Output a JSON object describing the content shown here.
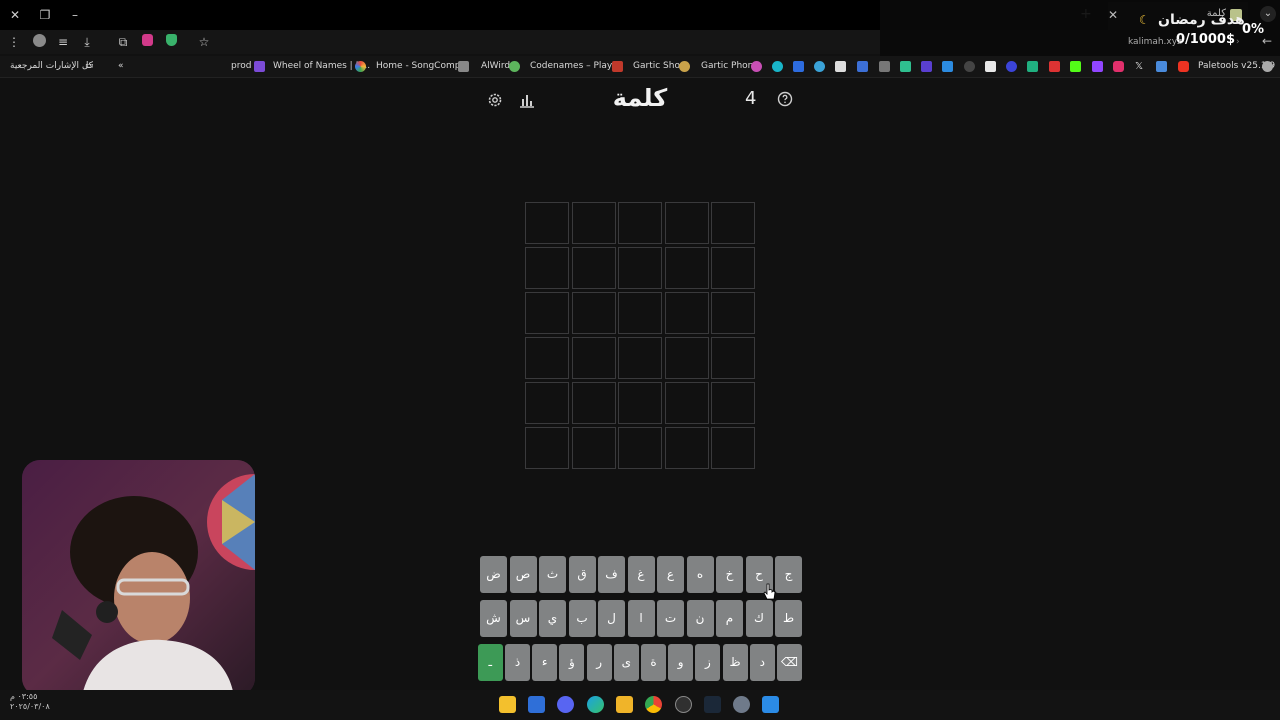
{
  "browser": {
    "tab_title": "كلمة",
    "url_domain": "kalimah.xyz",
    "all_bookmarks_label": "كل الإشارات المرجعية",
    "bookmarks": [
      "prod",
      "Wheel of Names | R...",
      "Home - SongComp...",
      "AlWird",
      "Codenames – Play...",
      "Gartic Show",
      "Gartic Phone",
      "Paletools v25.1.9"
    ]
  },
  "overlay": {
    "goal_label": "هدف رمضان",
    "goal_percent": "0%",
    "goal_amount": "0/1000$"
  },
  "game": {
    "title": "كلمة",
    "attempts": "4",
    "rows": 6,
    "cols": 5
  },
  "keyboard": {
    "row1": [
      "ج",
      "ح",
      "خ",
      "ه",
      "ع",
      "غ",
      "ف",
      "ق",
      "ث",
      "ص",
      "ض"
    ],
    "row2": [
      "ط",
      "ك",
      "م",
      "ن",
      "ت",
      "ا",
      "ل",
      "ب",
      "ي",
      "س",
      "ش"
    ],
    "row3": [
      "backspace-icon",
      "د",
      "ظ",
      "ز",
      "و",
      "ة",
      "ى",
      "ر",
      "ؤ",
      "ء",
      "ذ",
      "ـ"
    ]
  },
  "taskbar": {
    "clock_time": "٠٣:٥٥ م",
    "clock_date": "٢٠٢٥/٠٣/٠٨"
  }
}
